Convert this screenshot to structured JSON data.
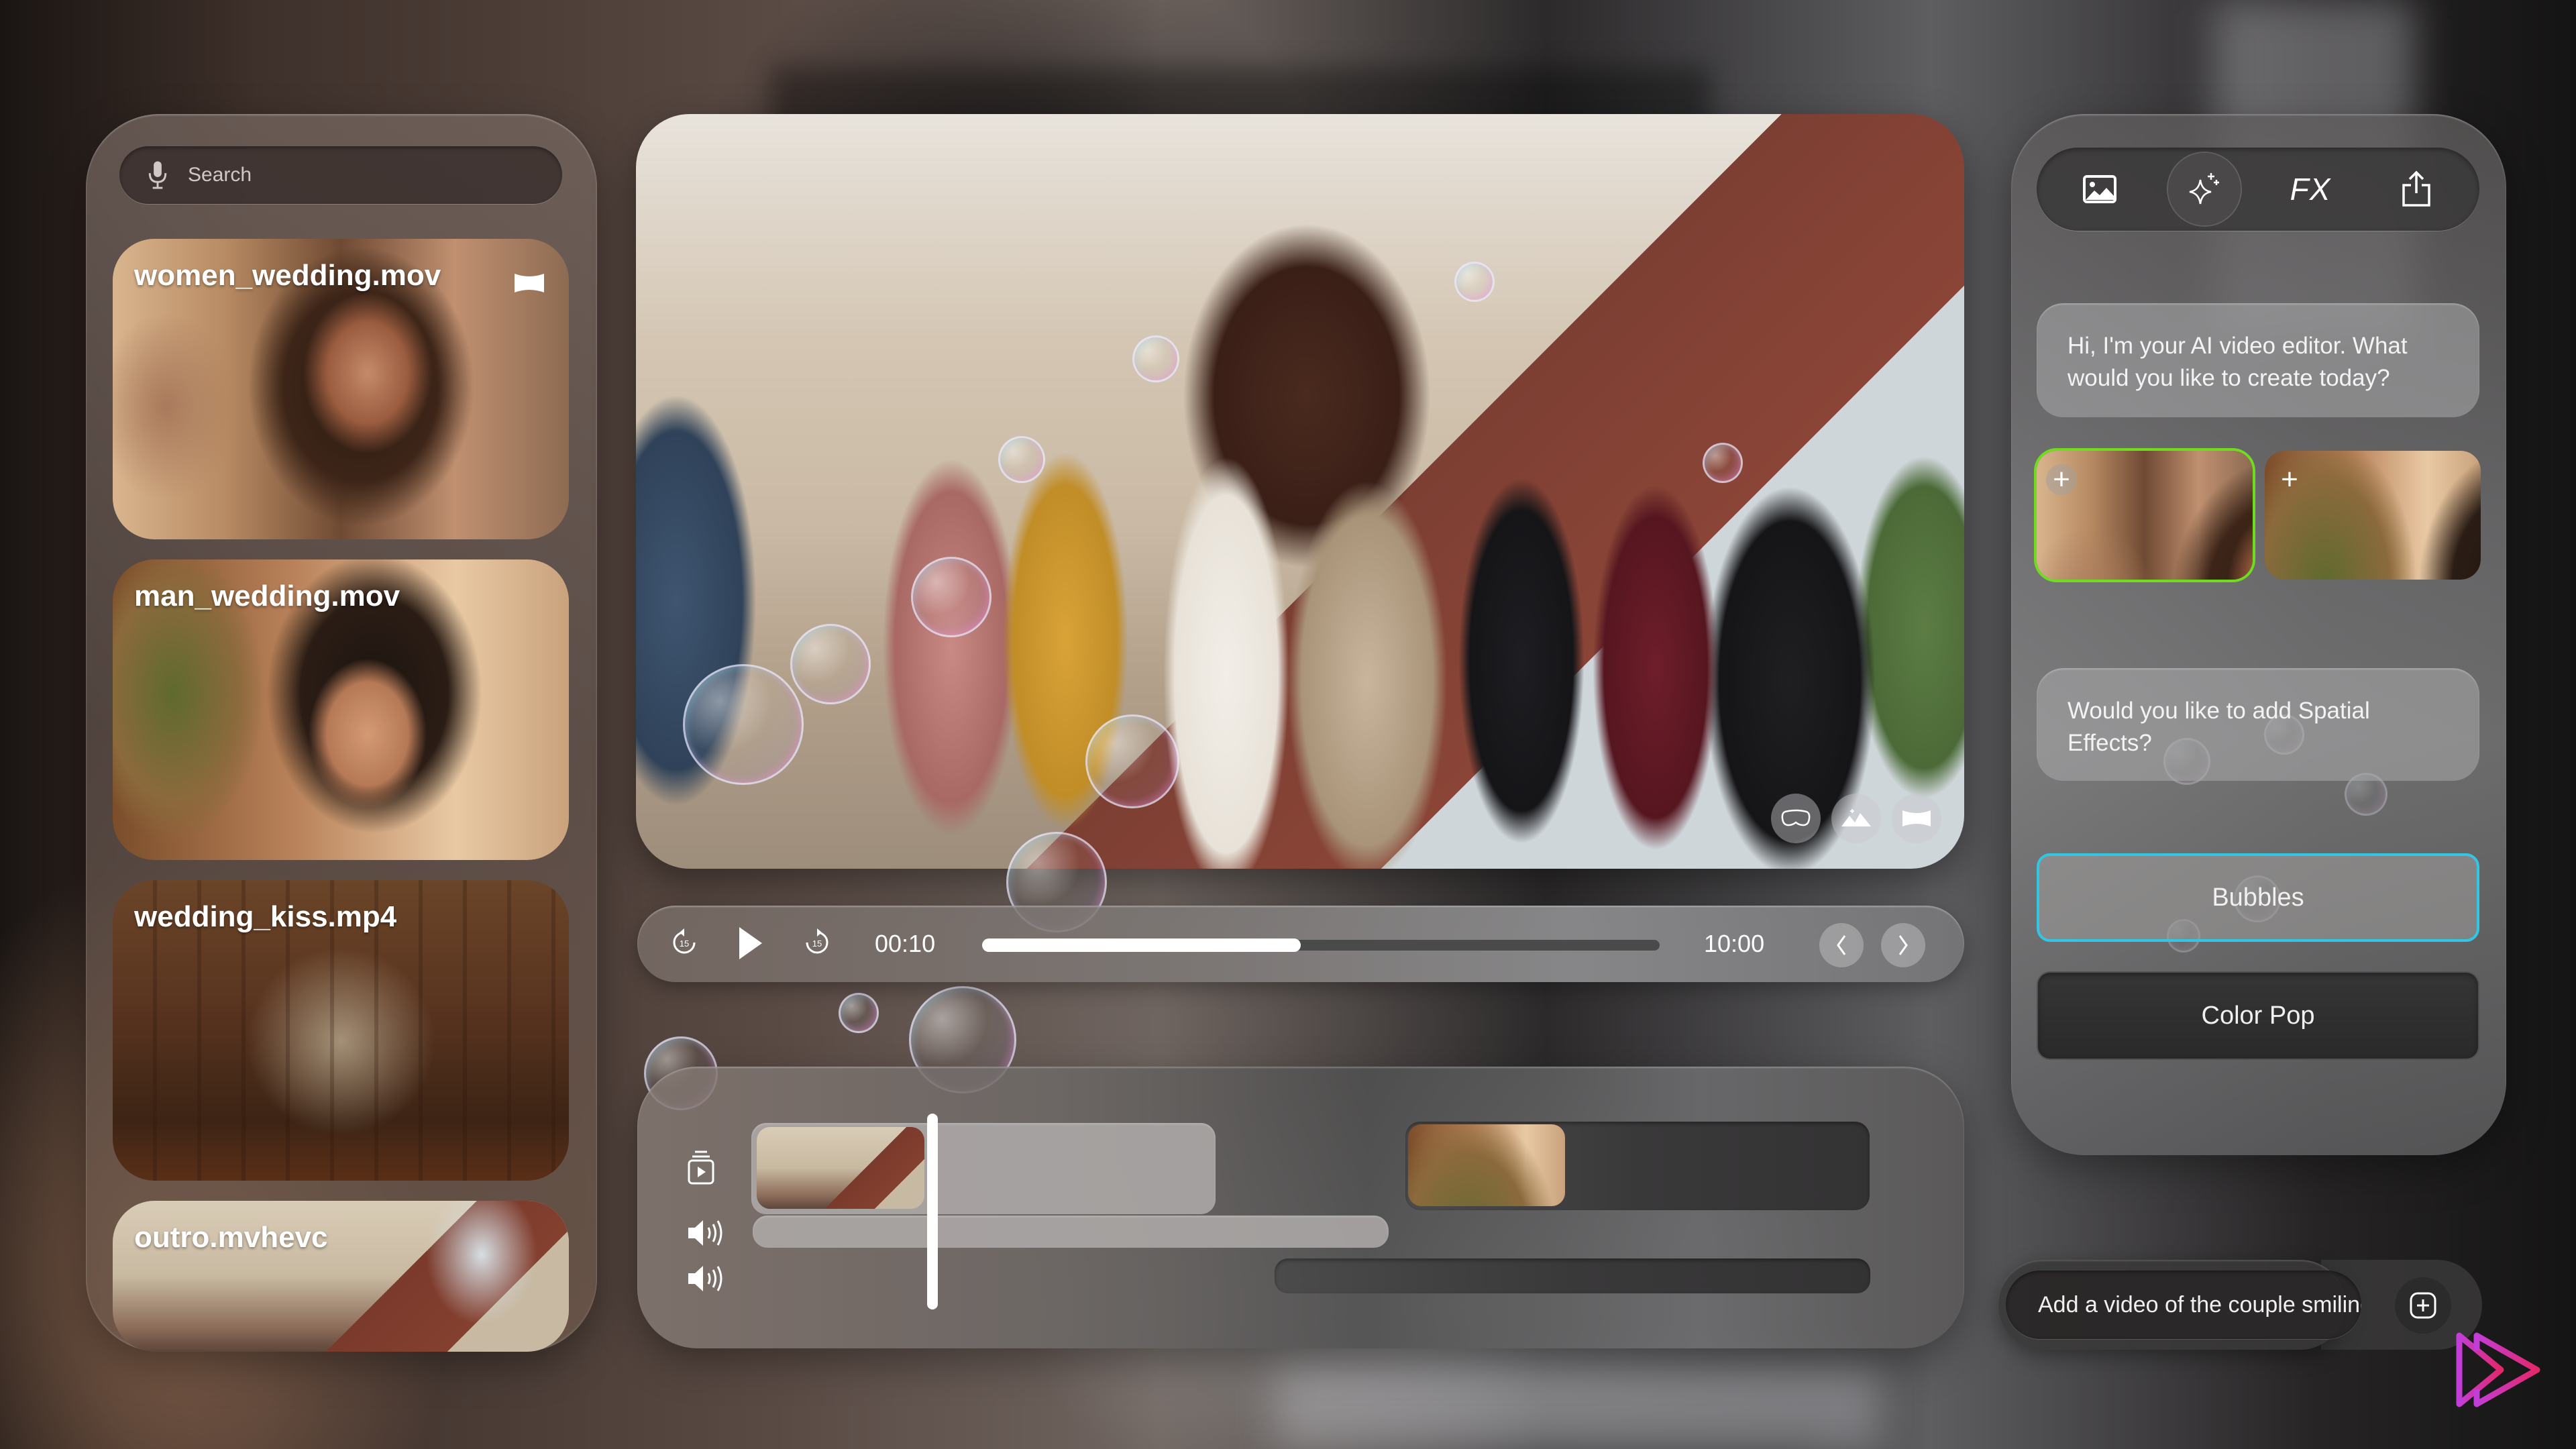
{
  "app": {
    "brand_colors": {
      "logo_start": "#c23ed8",
      "logo_end": "#e4276a",
      "selected_outline": "#6fdc1e",
      "effect_selected_border": "#31c6e4"
    }
  },
  "library": {
    "search": {
      "placeholder": "Search",
      "value": "",
      "icon": "mic-icon"
    },
    "items": [
      {
        "name": "women_wedding.mov",
        "badge_icon": "panorama-icon"
      },
      {
        "name": "man_wedding.mov"
      },
      {
        "name": "wedding_kiss.mp4"
      },
      {
        "name": "outro.mvhevc"
      }
    ]
  },
  "viewer": {
    "overlay_buttons": [
      {
        "icon": "vision-headset-icon",
        "label": "Immersive view"
      },
      {
        "icon": "mountains-sparkle-icon",
        "label": "Spatial photo"
      },
      {
        "icon": "panorama-icon",
        "label": "Panorama"
      }
    ]
  },
  "playback": {
    "skip_back_seconds": "15",
    "skip_forward_seconds": "15",
    "current_time": "00:10",
    "total_time": "10:00",
    "progress_fraction": 0.47,
    "prev_label": "Previous",
    "next_label": "Next"
  },
  "timeline": {
    "track_icons": [
      "video-track-icon",
      "audio-track-icon",
      "audio-track-icon"
    ],
    "playhead_fraction": 0.16
  },
  "assistant": {
    "tools": [
      {
        "icon": "photo-icon",
        "label": "Media"
      },
      {
        "icon": "sparkles-icon",
        "label": "AI",
        "active": true
      },
      {
        "label": "FX"
      },
      {
        "icon": "share-icon",
        "label": "Export"
      }
    ],
    "greeting": "Hi, I'm your AI video editor. What would you like to create today?",
    "suggestions": [
      {
        "clip": "women_wedding.mov",
        "selected": true,
        "add_label": "+"
      },
      {
        "clip": "man_wedding.mov",
        "selected": false,
        "add_label": "+"
      }
    ],
    "question": "Would you like to add Spatial Effects?",
    "effects": [
      {
        "label": "Bubbles",
        "selected": true
      },
      {
        "label": "Color Pop",
        "selected": false
      }
    ]
  },
  "prompt": {
    "value": "Add a video of the couple smiling",
    "add_icon": "plus-square-icon"
  }
}
